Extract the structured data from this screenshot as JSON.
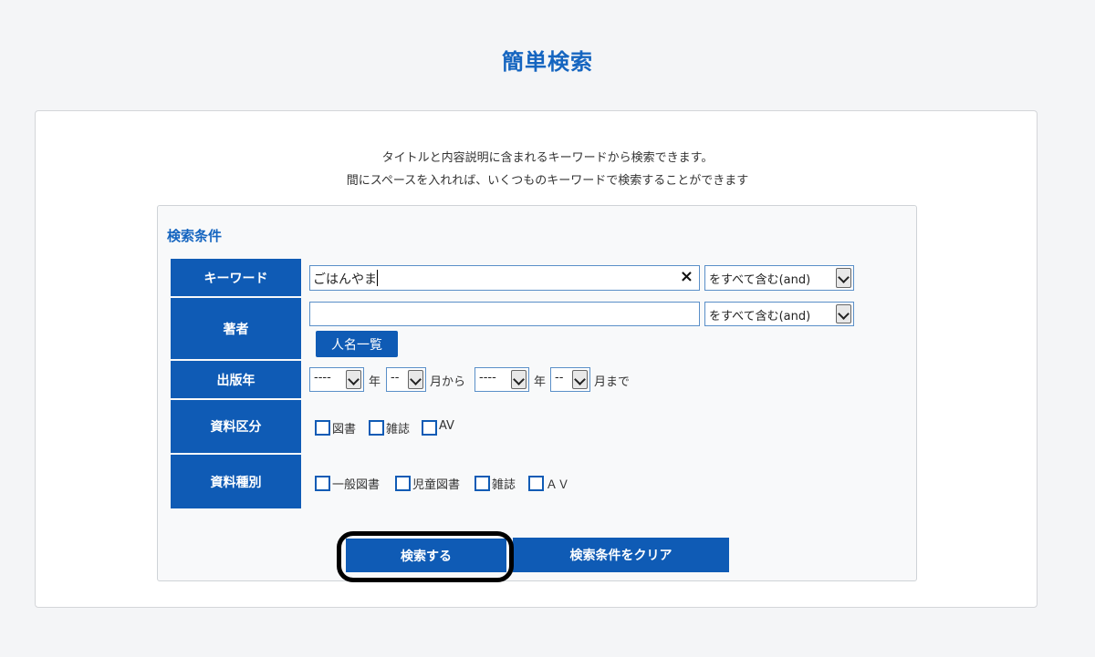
{
  "page_title": "簡単検索",
  "intro": {
    "line1": "タイトルと内容説明に含まれるキーワードから検索できます。",
    "line2": "間にスペースを入れれば、いくつものキーワードで検索することができます"
  },
  "section_title": "検索条件",
  "keyword": {
    "label": "キーワード",
    "value": "ごはんやま",
    "clear_icon": "×",
    "mode": "をすべて含む(and)"
  },
  "author": {
    "label": "著者",
    "value": "",
    "mode": "をすべて含む(and)",
    "list_button": "人名一覧"
  },
  "pub_year": {
    "label": "出版年",
    "from_year": "----",
    "year_unit": "年",
    "from_month": "--",
    "from_month_suffix": "月から",
    "to_year": "----",
    "to_month": "--",
    "to_month_suffix": "月まで"
  },
  "material_category": {
    "label": "資料区分",
    "options": [
      "図書",
      "雑誌",
      "AV"
    ]
  },
  "material_type": {
    "label": "資料種別",
    "options": [
      "一般図書",
      "児童図書",
      "雑誌",
      "ＡＶ"
    ]
  },
  "actions": {
    "search": "検索する",
    "clear": "検索条件をクリア"
  },
  "colors": {
    "accent": "#0f5bb5",
    "title": "#1565c0"
  }
}
